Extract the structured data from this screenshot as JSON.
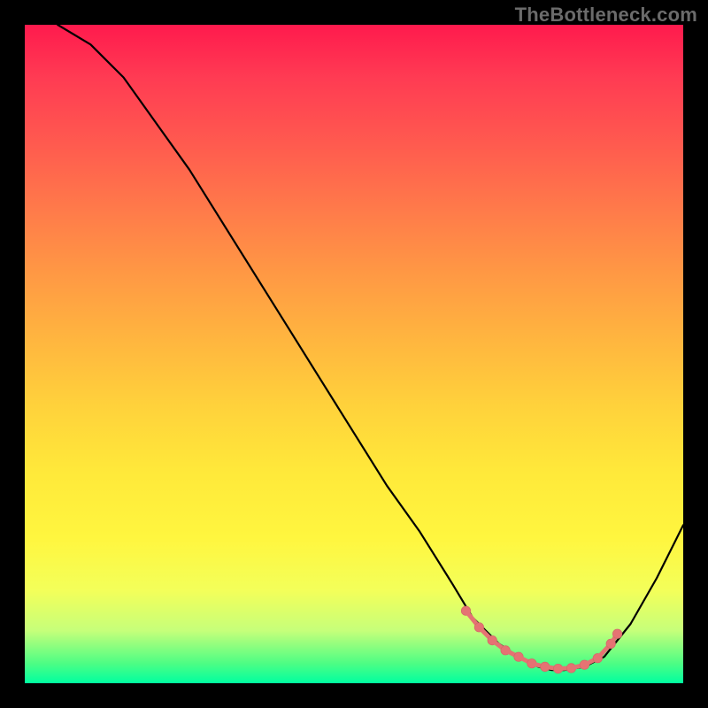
{
  "watermark": "TheBottleneck.com",
  "chart_data": {
    "type": "line",
    "title": "",
    "xlabel": "",
    "ylabel": "",
    "xlim": [
      0,
      100
    ],
    "ylim": [
      0,
      100
    ],
    "series": [
      {
        "name": "curve",
        "x": [
          5,
          10,
          15,
          20,
          25,
          30,
          35,
          40,
          45,
          50,
          55,
          60,
          65,
          68,
          72,
          75,
          78,
          80,
          82,
          85,
          88,
          92,
          96,
          100
        ],
        "y": [
          100,
          97,
          92,
          85,
          78,
          70,
          62,
          54,
          46,
          38,
          30,
          23,
          15,
          10,
          6,
          4,
          2.5,
          2,
          2,
          2.5,
          4,
          9,
          16,
          24
        ]
      }
    ],
    "highlight_region": {
      "name": "optimal-zone",
      "x_start": 67,
      "x_end": 90,
      "markers_x": [
        67,
        69,
        71,
        73,
        75,
        77,
        79,
        81,
        83,
        85,
        87,
        89,
        90
      ],
      "markers_y": [
        11,
        8.5,
        6.5,
        5,
        4,
        3,
        2.5,
        2.2,
        2.3,
        2.8,
        3.8,
        6,
        7.5
      ]
    }
  }
}
